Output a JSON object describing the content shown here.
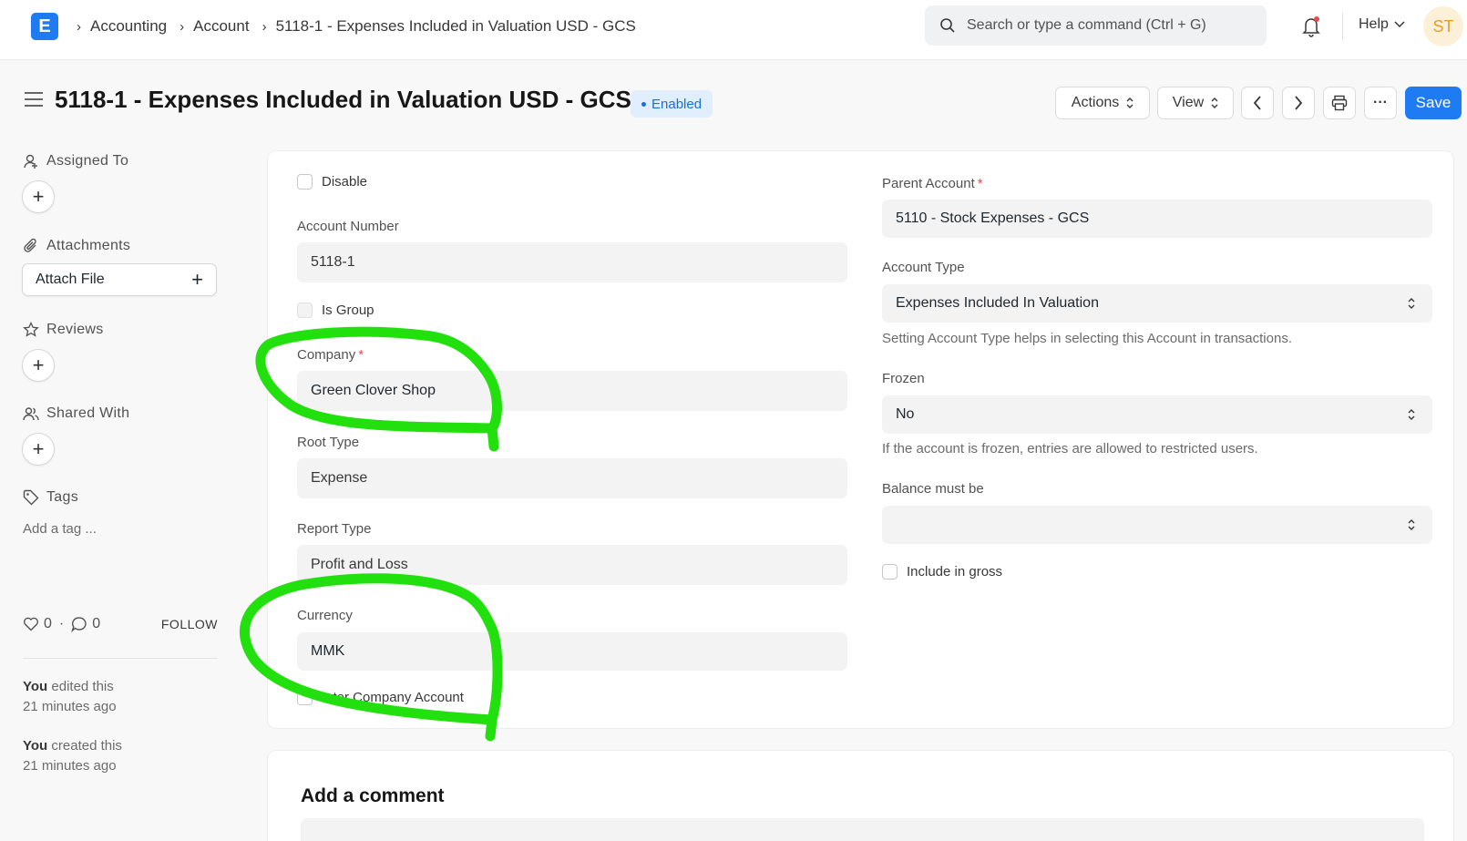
{
  "navbar": {
    "logo_letter": "E",
    "breadcrumbs": [
      "Accounting",
      "Account",
      "5118-1 - Expenses Included in Valuation USD - GCS"
    ],
    "search_placeholder": "Search or type a command (Ctrl + G)",
    "help_label": "Help",
    "avatar_initials": "ST"
  },
  "page": {
    "title": "5118-1 - Expenses Included in Valuation USD - GCS",
    "status_badge": "Enabled",
    "actions_label": "Actions",
    "view_label": "View",
    "more_label": "···",
    "save_label": "Save"
  },
  "sidebar": {
    "assigned_to": "Assigned To",
    "attachments": "Attachments",
    "attach_file": "Attach File",
    "reviews": "Reviews",
    "shared_with": "Shared With",
    "tags": "Tags",
    "add_tag": "Add a tag ...",
    "likes": "0",
    "comments": "0",
    "follow": "FOLLOW",
    "activity": [
      {
        "who": "You",
        "what": " edited this",
        "when": "21 minutes ago"
      },
      {
        "who": "You",
        "what": " created this",
        "when": "21 minutes ago"
      }
    ]
  },
  "form": {
    "disable_label": "Disable",
    "account_number_label": "Account Number",
    "account_number": "5118-1",
    "is_group_label": "Is Group",
    "company_label": "Company",
    "company": "Green Clover Shop",
    "root_type_label": "Root Type",
    "root_type": "Expense",
    "report_type_label": "Report Type",
    "report_type": "Profit and Loss",
    "currency_label": "Currency",
    "currency": "MMK",
    "inter_company_label": "Inter Company Account",
    "parent_account_label": "Parent Account",
    "parent_account": "5110 - Stock Expenses - GCS",
    "account_type_label": "Account Type",
    "account_type": "Expenses Included In Valuation",
    "account_type_help": "Setting Account Type helps in selecting this Account in transactions.",
    "frozen_label": "Frozen",
    "frozen": "No",
    "frozen_help": "If the account is frozen, entries are allowed to restricted users.",
    "balance_label": "Balance must be",
    "balance": "",
    "include_gross_label": "Include in gross"
  },
  "comments": {
    "title": "Add a comment"
  },
  "colors": {
    "primary": "#1e7bf1",
    "annotation": "#22e00e",
    "required": "#e24c4c"
  }
}
